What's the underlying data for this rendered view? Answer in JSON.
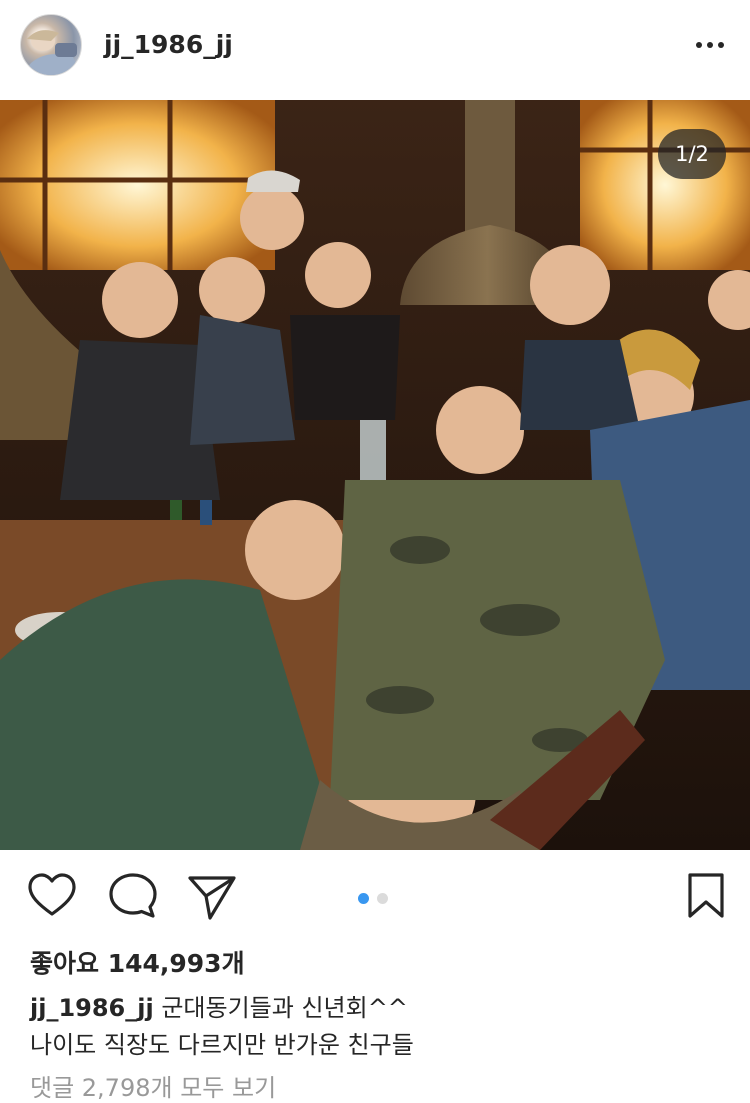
{
  "post": {
    "username": "jj_1986_jj",
    "slide_counter": "1/2",
    "current_slide": 1,
    "total_slides": 2,
    "likes_text": "좋아요 144,993개",
    "caption_username": "jj_1986_jj",
    "caption_line1": "군대동기들과 신년회^^",
    "caption_line2": "나이도 직장도 다르지만 반가운 친구들",
    "comments_link": "댓글 2,798개 모두 보기"
  },
  "icons": {
    "like": "heart-icon",
    "comment": "comment-icon",
    "share": "send-icon",
    "save": "bookmark-icon",
    "more": "more-options-icon"
  },
  "colors": {
    "text": "#262626",
    "muted": "#999999",
    "accent": "#3897f0",
    "inactive_dot": "#dbdbdb"
  }
}
